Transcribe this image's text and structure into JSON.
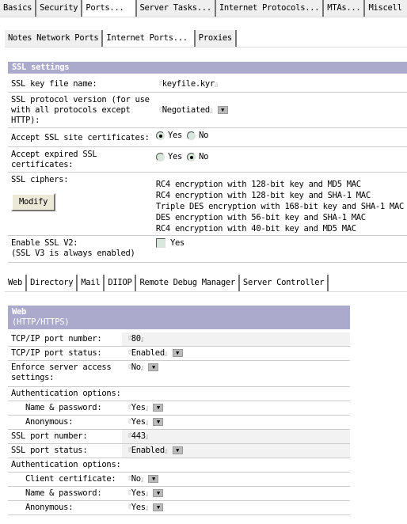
{
  "top_tabs": [
    {
      "label": "Basics"
    },
    {
      "label": "Security"
    },
    {
      "label": "Ports..."
    },
    {
      "label": "Server Tasks..."
    },
    {
      "label": "Internet Protocols..."
    },
    {
      "label": "MTAs..."
    },
    {
      "label": "Miscell"
    }
  ],
  "top_active": 2,
  "sub_tabs": [
    {
      "label": "Notes Network Ports"
    },
    {
      "label": "Internet Ports..."
    },
    {
      "label": "Proxies"
    }
  ],
  "ssl": {
    "title": "SSL settings",
    "key_file_label": "SSL key file name:",
    "key_file_value": "keyfile.kyr",
    "protocol_label": "SSL protocol version (for use with all protocols except HTTP):",
    "protocol_value": "Negotiated",
    "site_certs_label": "Accept SSL site certificates:",
    "site_certs_value": "Yes",
    "expired_label": "Accept expired SSL certificates:",
    "expired_value": "No",
    "yes": "Yes",
    "no": "No",
    "ciphers_label": "SSL ciphers:",
    "modify_label": "Modify",
    "ciphers": [
      "RC4 encryption with 128-bit key and MD5 MAC",
      "RC4 encryption with 128-bit key and SHA-1 MAC",
      "Triple DES encryption with 168-bit key and SHA-1 MAC",
      "DES encryption with 56-bit key and SHA-1 MAC",
      "RC4 encryption with 40-bit key and MD5 MAC"
    ],
    "v2_label": "Enable SSL V2:",
    "v2_note": "(SSL V3 is always enabled)",
    "v2_checked": false
  },
  "web_tabs": [
    {
      "label": "Web"
    },
    {
      "label": "Directory"
    },
    {
      "label": "Mail"
    },
    {
      "label": "DIIOP"
    },
    {
      "label": "Remote Debug Manager"
    },
    {
      "label": "Server Controller"
    }
  ],
  "web": {
    "title": "Web",
    "subtitle": "(HTTP/HTTPS)",
    "rows": [
      {
        "label": "TCP/IP port number:",
        "value": "80"
      },
      {
        "label": "TCP/IP port status:",
        "value": "Enabled"
      },
      {
        "label": "Enforce server access settings:",
        "value": "No"
      },
      {
        "label": "Authentication options:"
      },
      {
        "label": "Name & password:",
        "value": "Yes"
      },
      {
        "label": "Anonymous:",
        "value": "Yes"
      },
      {
        "label": "SSL port number:",
        "value": "443"
      },
      {
        "label": "SSL port status:",
        "value": "Enabled"
      },
      {
        "label": "Authentication options:"
      },
      {
        "label": "Client certificate:",
        "value": "No"
      },
      {
        "label": "Name & password:",
        "value": "Yes"
      },
      {
        "label": "Anonymous:",
        "value": "Yes"
      }
    ]
  }
}
